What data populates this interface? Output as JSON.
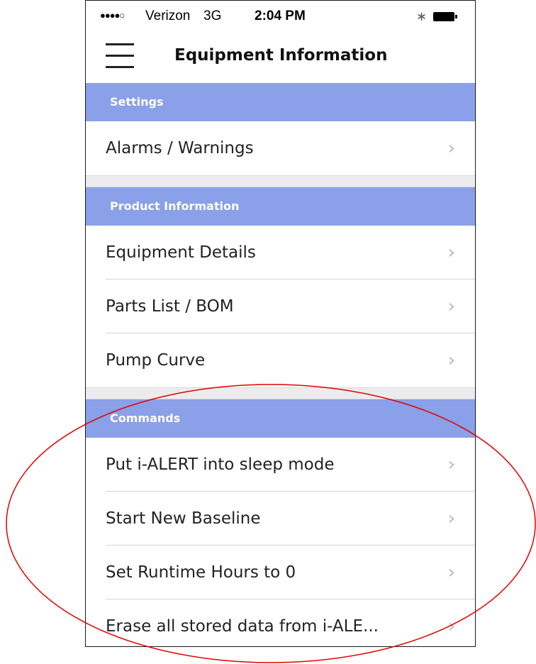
{
  "status_bar": {
    "signal": "●●●●○",
    "carrier": "Verizon",
    "network": "3G",
    "time": "2:04 PM",
    "bluetooth_icon": "bluetooth-icon",
    "battery_icon": "battery-icon"
  },
  "nav": {
    "menu_icon": "hamburger-menu-icon",
    "title": "Equipment Information"
  },
  "sections": {
    "settings": {
      "title": "Settings",
      "items": [
        "Alarms / Warnings"
      ]
    },
    "product_information": {
      "title": "Product Information",
      "items": [
        "Equipment Details",
        "Parts List / BOM",
        "Pump Curve"
      ]
    },
    "commands": {
      "title": "Commands",
      "items": [
        "Put i-ALERT into sleep mode",
        "Start New Baseline",
        "Set Runtime Hours to 0",
        "Erase all stored data from i-ALE..."
      ]
    }
  },
  "chevron": "›",
  "colors": {
    "section_header_bg": "#8aa0e8",
    "annotation_ellipse": "#e00000"
  }
}
